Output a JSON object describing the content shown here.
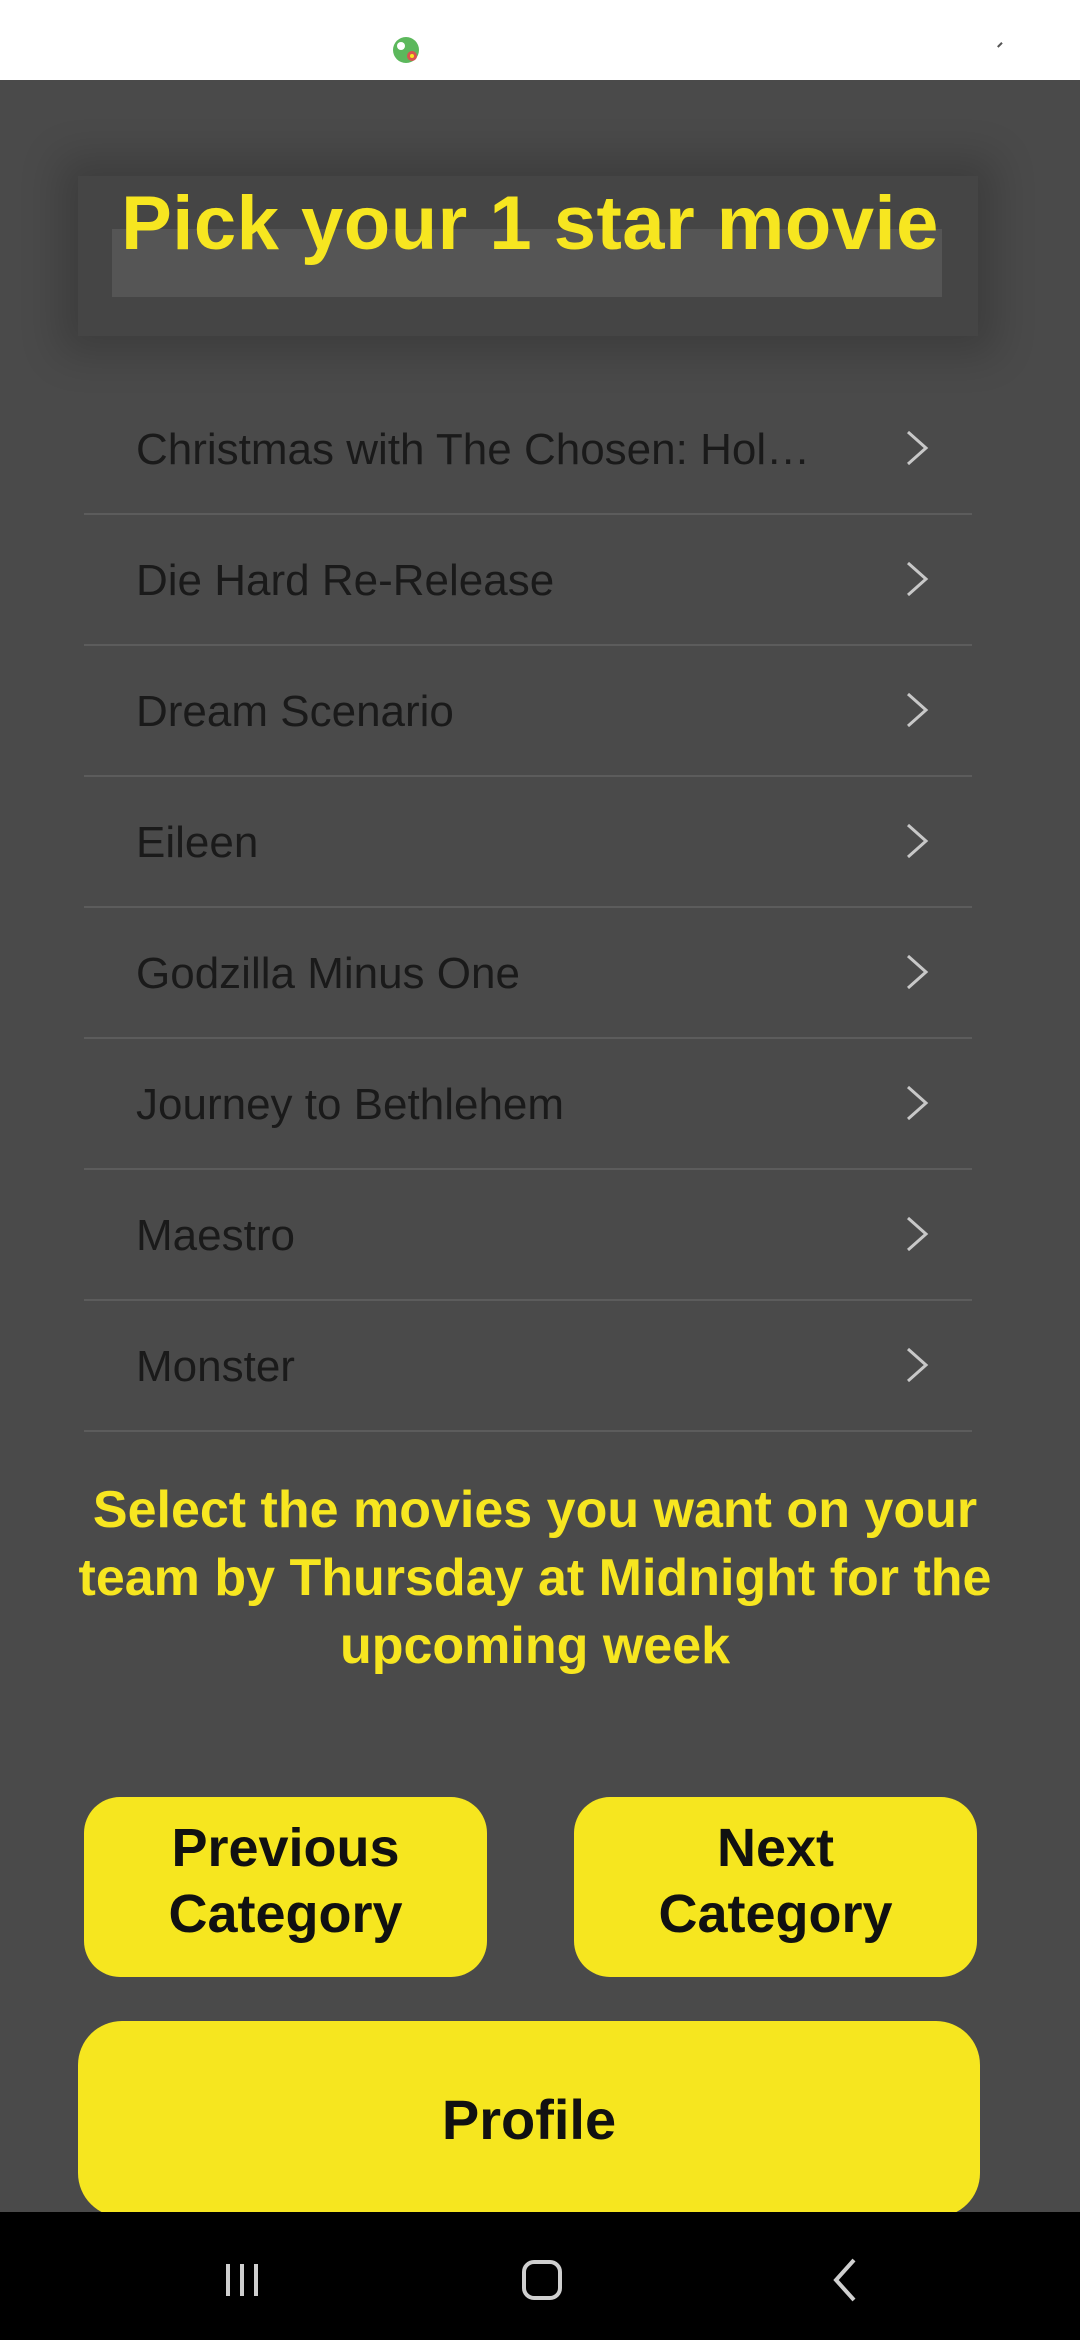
{
  "status_bar": {
    "app_icon": "app-notification-icon",
    "status_icon": "signal-tick-icon"
  },
  "header": {
    "title": "Pick your 1 star movie"
  },
  "movies": [
    {
      "label": "Christmas with The Chosen: Hol…"
    },
    {
      "label": "Die Hard Re-Release"
    },
    {
      "label": "Dream Scenario"
    },
    {
      "label": "Eileen"
    },
    {
      "label": "Godzilla Minus One"
    },
    {
      "label": "Journey to Bethlehem"
    },
    {
      "label": "Maestro"
    },
    {
      "label": "Monster"
    }
  ],
  "instructions": "Select the movies you want on your team by Thursday at Midnight for the upcoming week",
  "buttons": {
    "previous_line1": "Previous",
    "previous_line2": "Category",
    "next_line1": "Next",
    "next_line2": "Category",
    "profile": "Profile"
  },
  "colors": {
    "background": "#4a4a4a",
    "accent_yellow": "#f7e620",
    "button_yellow": "#f6e61f",
    "nav_bar": "#000000"
  },
  "nav": {
    "recents_icon": "recents-icon",
    "home_icon": "home-icon",
    "back_icon": "back-icon"
  }
}
